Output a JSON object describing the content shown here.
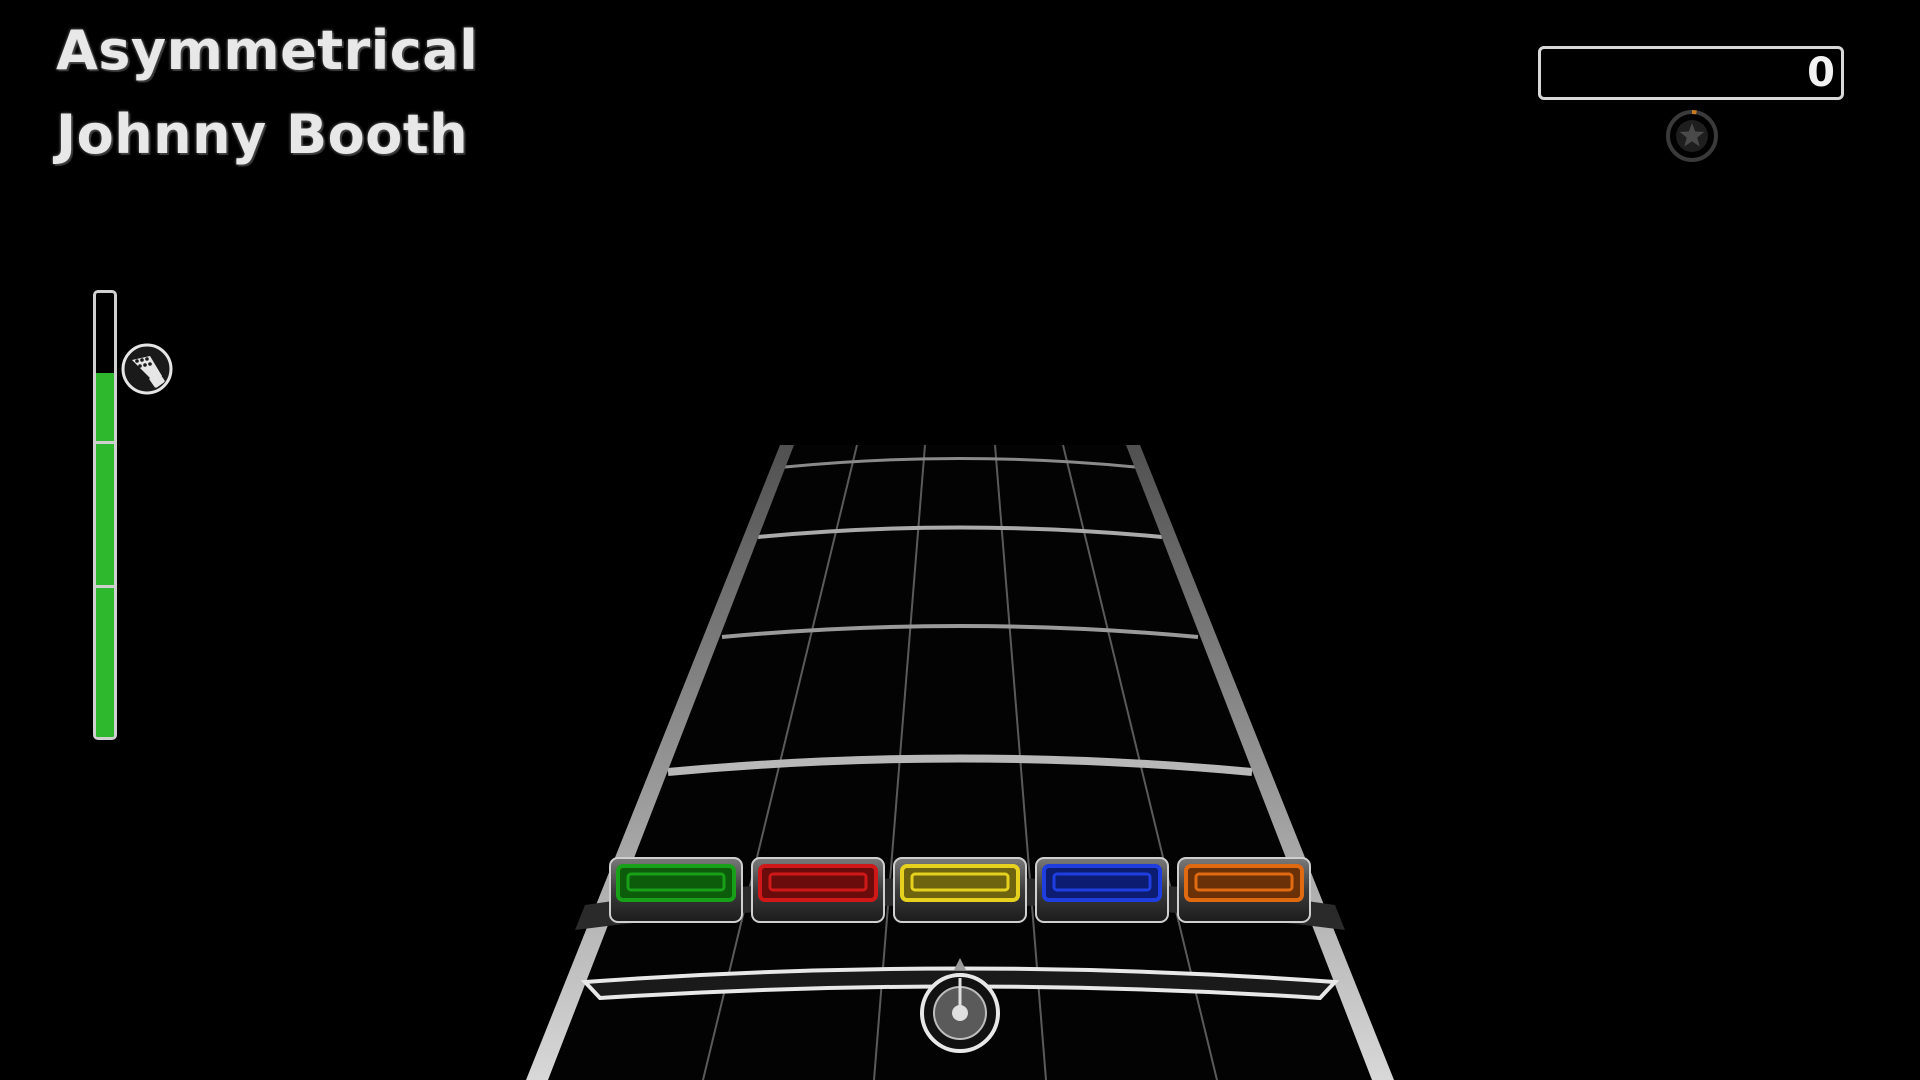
{
  "song": {
    "title": "Asymmetrical",
    "artist": "Johnny Booth"
  },
  "score": {
    "value": "0"
  },
  "star_meter": {
    "icon": "star-icon",
    "progress": 0.03,
    "color": "#c87820"
  },
  "rock_meter": {
    "level": 0.82,
    "fill_color": "#2db82d",
    "icon": "guitar-headstock-icon"
  },
  "frets": [
    {
      "name": "green",
      "color": "#18a018",
      "glow": "#0c5c0c"
    },
    {
      "name": "red",
      "color": "#d01818",
      "glow": "#6a0c0c"
    },
    {
      "name": "yellow",
      "color": "#e6d21e",
      "glow": "#6e6410"
    },
    {
      "name": "blue",
      "color": "#1e3ee0",
      "glow": "#0c1c70"
    },
    {
      "name": "orange",
      "color": "#e06a12",
      "glow": "#6a3008"
    }
  ]
}
